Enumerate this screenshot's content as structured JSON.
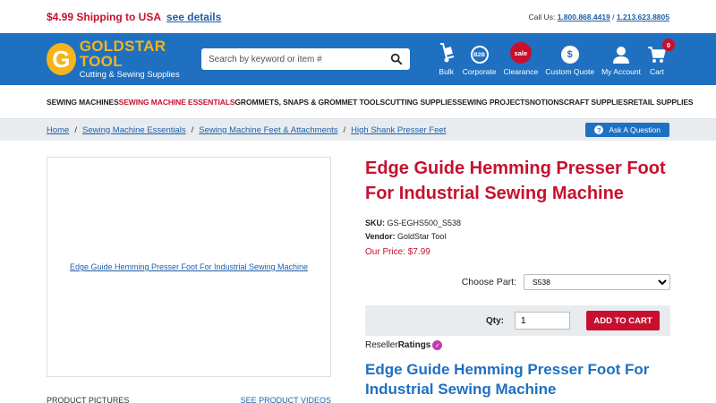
{
  "promo": {
    "text": "$4.99 Shipping to USA",
    "link": "see details"
  },
  "callus": {
    "label": "Call Us:",
    "phone1": "1.800.868.4419",
    "sep": "/",
    "phone2": "1.213.623.8805"
  },
  "brand": {
    "name": "GOLDSTAR TOOL",
    "tagline": "Cutting & Sewing Supplies",
    "initial": "G"
  },
  "search": {
    "placeholder": "Search by keyword or item #"
  },
  "header_icons": [
    {
      "label": "Bulk",
      "icon": "dolly-icon"
    },
    {
      "label": "Corporate",
      "icon": "b2b-icon",
      "badge": "B2B"
    },
    {
      "label": "Clearance",
      "icon": "sale-icon",
      "badge": "sale"
    },
    {
      "label": "Custom Quote",
      "icon": "dollar-icon",
      "badge": "$"
    },
    {
      "label": "My Account",
      "icon": "user-icon"
    },
    {
      "label": "Cart",
      "icon": "cart-icon",
      "count": "0"
    }
  ],
  "nav": [
    "SEWING MACHINES",
    "SEWING MACHINE ESSENTIALS",
    "GROMMETS, SNAPS & GROMMET TOOLS",
    "CUTTING SUPPLIES",
    "SEWING PROJECTS",
    "NOTIONS",
    "CRAFT SUPPLIES",
    "RETAIL SUPPLIES"
  ],
  "breadcrumbs": [
    "Home",
    "Sewing Machine Essentials",
    "Sewing Machine Feet & Attachments",
    "High Shank Presser Feet"
  ],
  "ask_label": "Ask A Question",
  "product": {
    "image_alt": "Edge Guide Hemming Presser Foot For Industrial Sewing Machine",
    "title_line1": "Edge Guide Hemming Presser Foot",
    "title_line2": "For Industrial Sewing Machine",
    "sku_label": "SKU:",
    "sku": "GS-EGHS500_S538",
    "vendor_label": "Vendor:",
    "vendor": "GoldStar Tool",
    "price_label": "Our Price:",
    "price": "$7.99",
    "choose_label": "Choose Part:",
    "part_selected": "S538",
    "qty_label": "Qty:",
    "qty": "1",
    "add_to_cart": "ADD TO CART",
    "reseller_a": "Reseller",
    "reseller_b": "Ratings",
    "subtitle_line1": "Edge Guide Hemming Presser Foot For",
    "subtitle_line2": "Industrial Sewing Machine"
  },
  "tabs": {
    "pictures": "PRODUCT PICTURES",
    "videos": "SEE PRODUCT VIDEOS"
  },
  "colors": {
    "brand_blue": "#1f70c1",
    "brand_red": "#c8102e",
    "brand_gold": "#f5b41a"
  }
}
